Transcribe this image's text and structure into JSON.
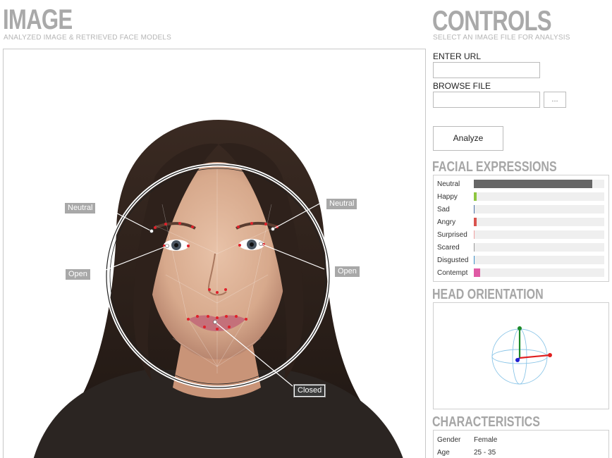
{
  "image_section": {
    "title": "IMAGE",
    "subtitle": "ANALYZED IMAGE & RETRIEVED FACE MODELS",
    "labels": {
      "left_brow": "Neutral",
      "right_brow": "Neutral",
      "left_eye": "Open",
      "right_eye": "Open",
      "mouth": "Closed"
    }
  },
  "controls": {
    "title": "CONTROLS",
    "subtitle": "SELECT AN IMAGE FILE FOR ANALYSIS",
    "url_label": "ENTER URL",
    "url_value": "",
    "browse_label": "BROWSE FILE",
    "browse_value": "",
    "browse_button": "...",
    "analyze_button": "Analyze"
  },
  "facial_expressions": {
    "title": "FACIAL EXPRESSIONS",
    "items": [
      {
        "label": "Neutral",
        "value": 0.91,
        "color": "#666666"
      },
      {
        "label": "Happy",
        "value": 0.02,
        "color": "#8ec63f"
      },
      {
        "label": "Sad",
        "value": 0.005,
        "color": "#4a6fa5"
      },
      {
        "label": "Angry",
        "value": 0.02,
        "color": "#d9534f"
      },
      {
        "label": "Surprised",
        "value": 0.004,
        "color": "#f0a0a0"
      },
      {
        "label": "Scared",
        "value": 0.004,
        "color": "#999999"
      },
      {
        "label": "Disgusted",
        "value": 0.008,
        "color": "#3a8fc7"
      },
      {
        "label": "Contempt",
        "value": 0.05,
        "color": "#e05aa5"
      }
    ]
  },
  "head_orientation": {
    "title": "HEAD ORIENTATION"
  },
  "characteristics": {
    "title": "CHARACTERISTICS",
    "rows": [
      {
        "key": "Gender",
        "value": "Female"
      },
      {
        "key": "Age",
        "value": "25 - 35"
      }
    ]
  }
}
